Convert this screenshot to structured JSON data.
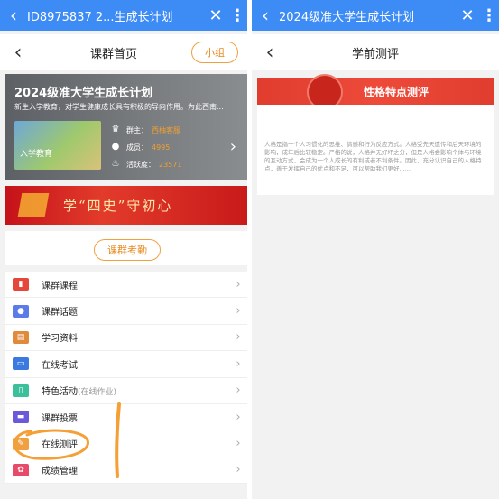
{
  "left": {
    "topbar": {
      "back_icon": "back-chevron",
      "title": "ID8975837 2...生成长计划",
      "close_icon": "close",
      "more_icon": "more-vertical"
    },
    "nav": {
      "back_icon": "back-chevron",
      "title": "课群首页",
      "group_button": "小组"
    },
    "group_banner": {
      "title": "2024级准大学生成长计划",
      "description": "新生入学教育，对学生健康成长具有积极的导向作用。为此西南...",
      "thumbnail_label": "入学教育",
      "stats": [
        {
          "icon": "crown-icon",
          "label": "群主：",
          "value": "西柚客服"
        },
        {
          "icon": "members-icon",
          "label": "成员：",
          "value": "4995"
        },
        {
          "icon": "flame-icon",
          "label": "活跃度：",
          "value": "23571"
        }
      ]
    },
    "promo_banner": {
      "text": "学“四史”守初心"
    },
    "check_in_button": "课群考勤",
    "menu": [
      {
        "name": "menu-course",
        "icon": "book-icon",
        "color": "#e5473a",
        "label": "课群课程",
        "sub": ""
      },
      {
        "name": "menu-topics",
        "icon": "chat-bubbles-icon",
        "color": "#5b7ce8",
        "label": "课群话题",
        "sub": ""
      },
      {
        "name": "menu-materials",
        "icon": "materials-icon",
        "color": "#e08a3c",
        "label": "学习资料",
        "sub": ""
      },
      {
        "name": "menu-exam",
        "icon": "laptop-icon",
        "color": "#3a79e0",
        "label": "在线考试",
        "sub": ""
      },
      {
        "name": "menu-activity",
        "icon": "clipboard-icon",
        "color": "#3cbf9b",
        "label": "特色活动",
        "sub": "(在线作业)"
      },
      {
        "name": "menu-vote",
        "icon": "vote-icon",
        "color": "#6a59d8",
        "label": "课群投票",
        "sub": ""
      },
      {
        "name": "menu-assessment",
        "icon": "pen-icon",
        "color": "#f0a040",
        "label": "在线测评",
        "sub": ""
      },
      {
        "name": "menu-grades",
        "icon": "ribbon-icon",
        "color": "#e84a6a",
        "label": "成绩管理",
        "sub": ""
      }
    ],
    "chevron_glyph": "›"
  },
  "right": {
    "topbar": {
      "back_icon": "back-chevron",
      "title": "2024级准大学生成长计划",
      "close_icon": "close",
      "more_icon": "more-vertical"
    },
    "nav": {
      "back_icon": "back-chevron",
      "title": "学前测评"
    },
    "test_card": {
      "title": "性格特点测评",
      "description": "人格是指一个人习惯化的思维、情感和行为反应方式。人格受先天遗传和后天环境的影响，成年后比较稳定。严格的说，人格并无好坏之分，但是人格会影响个体与环境的互动方式，会成为一个人成长的有利或者不利条件。因此，充分认识自己的人格特点，善于发挥自己的优点和不足，可以帮助我们更好......"
    }
  },
  "colors": {
    "topbar_blue": "#3d8bf5",
    "accent_orange": "#e88b20",
    "test_red": "#e13d2f",
    "annotation_orange": "#f5a037"
  }
}
